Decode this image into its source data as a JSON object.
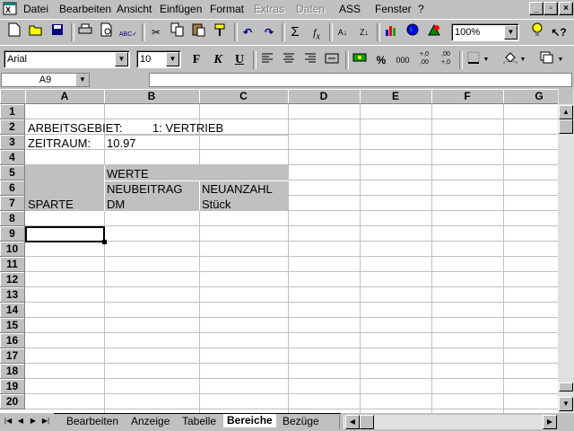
{
  "menu": [
    "Datei",
    "Bearbeiten",
    "Ansicht",
    "Einfügen",
    "Format",
    "Extras",
    "Daten",
    "ASS",
    "Fenster",
    "?"
  ],
  "menu_disabled": [
    "Extras",
    "Daten"
  ],
  "toolbar": {
    "zoom": "100%"
  },
  "format_toolbar": {
    "font": "Arial",
    "size": "10",
    "bold": "F",
    "italic": "K",
    "underline": "U",
    "percent": "%",
    "thousands": "000"
  },
  "formula_bar": {
    "cell_ref": "A9",
    "content": ""
  },
  "columns": [
    "A",
    "B",
    "C",
    "D",
    "E",
    "F",
    "G"
  ],
  "rows": [
    "1",
    "2",
    "3",
    "4",
    "5",
    "6",
    "7",
    "8",
    "9",
    "10",
    "11",
    "12",
    "13",
    "14",
    "15",
    "16",
    "17",
    "18",
    "19",
    "20"
  ],
  "cells": {
    "A2": "ARBEITSGEBIET:",
    "B2": "1: VERTRIEB",
    "A3": "ZEITRAUM:",
    "B3": "10.97",
    "B5": "WERTE",
    "B6": "NEUBEITRAG",
    "C6": "NEUANZAHL",
    "A7": "SPARTE",
    "B7": "DM",
    "C7": "Stück"
  },
  "sheet_tabs": [
    "Bearbeiten",
    "Anzeige",
    "Tabelle",
    "Bereiche",
    "Bezüge"
  ],
  "active_tab": "Bereiche"
}
